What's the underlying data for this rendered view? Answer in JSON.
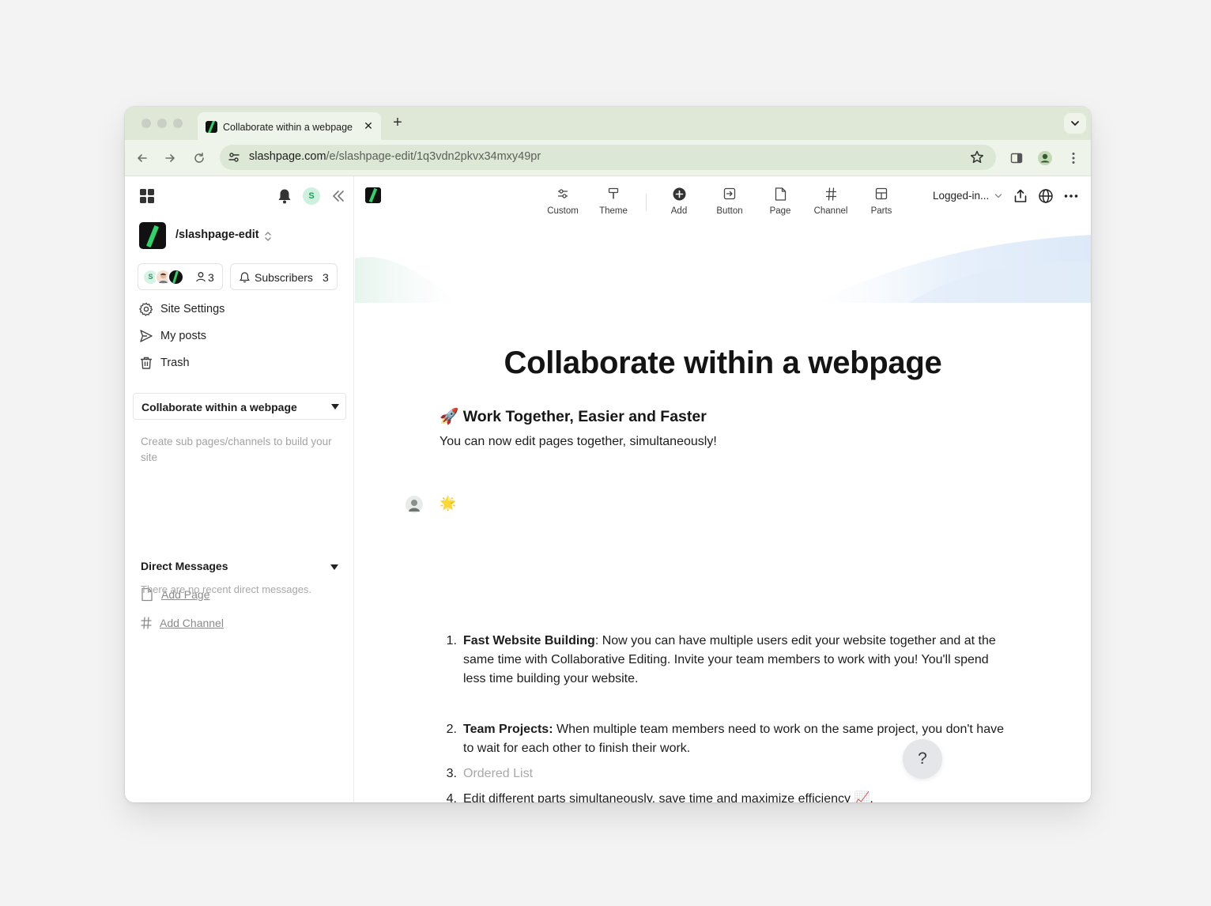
{
  "browser": {
    "tab_title": "Collaborate within a webpage",
    "tab_close": "✕",
    "new_tab": "+",
    "url_host": "slashpage.com",
    "url_path": "/e/slashpage-edit/1q3vdn2pkvx34mxy49pr"
  },
  "sidebar": {
    "notification_avatar_letter": "S",
    "site_name": "/slashpage-edit",
    "members": {
      "avatar_letter": "S",
      "count": "3"
    },
    "subscribers": {
      "label": "Subscribers",
      "count": "3"
    },
    "menu": [
      {
        "label": "Site Settings",
        "icon": "gear-icon"
      },
      {
        "label": "My posts",
        "icon": "send-icon"
      },
      {
        "label": "Trash",
        "icon": "trash-icon"
      }
    ],
    "current_page": "Collaborate within a webpage",
    "hint": "Create sub pages/channels to build your site",
    "add_page": "Add Page",
    "add_channel": "Add Channel",
    "direct_messages": {
      "title": "Direct Messages",
      "empty": "There are no recent direct messages."
    }
  },
  "editor_toolbar": {
    "tools": [
      {
        "label": "Custom",
        "icon": "sliders-icon"
      },
      {
        "label": "Theme",
        "icon": "paint-roller-icon"
      },
      {
        "label": "Add",
        "icon": "plus-circle-icon"
      },
      {
        "label": "Button",
        "icon": "button-icon"
      },
      {
        "label": "Page",
        "icon": "page-icon"
      },
      {
        "label": "Channel",
        "icon": "hash-icon"
      },
      {
        "label": "Parts",
        "icon": "layout-icon"
      }
    ],
    "visibility": "Logged-in..."
  },
  "content": {
    "title": "Collaborate within a webpage",
    "heading_emoji": "🚀",
    "heading": "Work Together, Easier and Faster",
    "intro": "You can now edit pages together, simultaneously!",
    "sparkle": "🌟",
    "list": [
      {
        "num": "1.",
        "bold": "Fast Website Building",
        "text": ": Now you can have multiple users edit your website together and at the same time with Collaborative Editing. Invite your team members to work with you! You'll spend less time building your website."
      },
      {
        "num": "2.",
        "bold": "Team Projects:",
        "text": " When multiple team members need to work on the same project, you don't have to wait for each other to finish their work."
      },
      {
        "num": "3.",
        "placeholder": "Ordered List"
      },
      {
        "num": "4.",
        "text": "Edit different parts simultaneously, save time and maximize efficiency 📈."
      }
    ]
  },
  "help_label": "?",
  "colors": {
    "brand_green": "#2fd36a",
    "tab_strip": "#dfe8d6",
    "toolbar": "#eef4ea"
  }
}
